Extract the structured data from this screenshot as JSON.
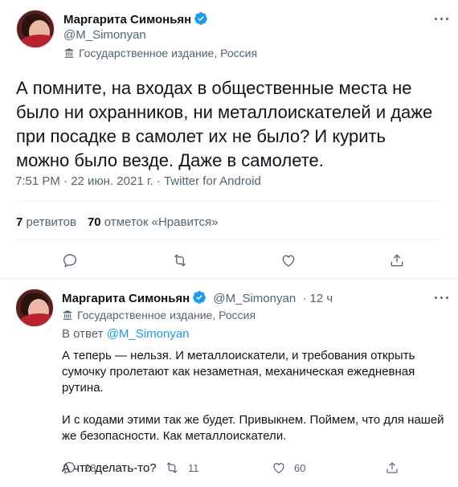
{
  "main_tweet": {
    "author_name": "Маргарита Симоньян",
    "author_handle": "@M_Simonyan",
    "state_label": "Государственное издание, Россия",
    "text": "А помните, на входах в общественные места не было ни охранников, ни металлоискателей и даже при посадке в самолет их не было? И курить можно было везде. Даже в самолете.",
    "meta": "7:51 PM · 22 июн. 2021 г. · Twitter for Android",
    "retweets_count": "7",
    "retweets_label": "ретвитов",
    "likes_count": "70",
    "likes_label": "отметок «Нравится»"
  },
  "reply_tweet": {
    "author_name": "Маргарита Симоньян",
    "author_handle": "@M_Simonyan",
    "time": "· 12 ч",
    "state_label": "Государственное издание, Россия",
    "in_reply_prefix": "В ответ",
    "in_reply_handle": "@M_Simonyan",
    "paragraphs": [
      "А теперь — нельзя. И металлоискатели, и требования открыть сумочку пролетают как незаметная, механическая ежедневная рутина.",
      "И с кодами этими так же будет. Привыкнем. Поймем, что для нашей же безопасности. Как металлоискатели.",
      "А что делать-то?"
    ],
    "replies": "28",
    "retweets": "11",
    "likes": "60"
  },
  "colors": {
    "verified": "#1d9bf0",
    "text": "#0f1419",
    "secondary": "#536471",
    "link": "#1d9bf0"
  },
  "icons": [
    "verified-badge-icon",
    "more-icon",
    "state-flag-icon",
    "reply-icon",
    "retweet-icon",
    "like-icon",
    "share-icon"
  ]
}
